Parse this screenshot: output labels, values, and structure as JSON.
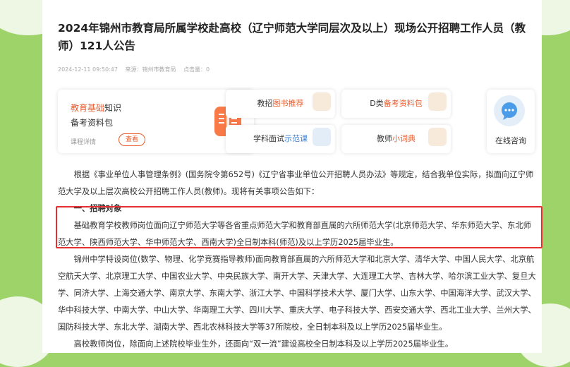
{
  "article": {
    "title": "2024年锦州市教育局所属学校赴高校（辽宁师范大学同层次及以上）现场公开招聘工作人员（教师）121人公告",
    "date": "2024-12-11 09:50:47",
    "source": "来源：锦州市教育局",
    "views": "点击量：0"
  },
  "promo": {
    "big_card": {
      "line1_highlight": "教育基础",
      "line1_rest": "知识",
      "line2": "备考资料包",
      "detail": "课程详情",
      "button": "查看",
      "icon": "book-icon"
    },
    "cards": [
      {
        "prefix": "教招",
        "highlight": "图书推荐",
        "suffix": ""
      },
      {
        "prefix": "D类",
        "highlight": "备考资料包",
        "suffix": ""
      },
      {
        "prefix": "学科面试",
        "highlight": "示范课",
        "suffix": ""
      },
      {
        "prefix": "教师",
        "highlight": "小词典",
        "suffix": ""
      }
    ],
    "right_card": {
      "label": "在线咨询",
      "icon": "chat-icon"
    }
  },
  "body": {
    "para1": "根据《事业单位人事管理条例》(国务院令第652号)《辽宁省事业单位公开招聘人员办法》等规定，结合我单位实际，拟面向辽宁师范大学及以上层次高校公开招聘工作人员(教师)。现将有关事项公告如下：",
    "section1": "一、招聘对象",
    "para2": "基础教育学校教师岗位面向辽宁师范大学等各省重点师范大学和教育部直属的六所师范大学(北京师范大学、华东师范大学、东北师范大学、陕西师范大学、华中师范大学、西南大学)全日制本科(师范)及以上学历2025届毕业生。",
    "para3": "锦州中学特设岗位(数学、物理、化学竞赛指导教师)面向教育部直属的六所师范大学和北京大学、清华大学、中国人民大学、北京航空航天大学、北京理工大学、中国农业大学、中央民族大学、南开大学、天津大学、大连理工大学、吉林大学、哈尔滨工业大学、复旦大学、同济大学、上海交通大学、南京大学、东南大学、浙江大学、中国科学技术大学、厦门大学、山东大学、中国海洋大学、武汉大学、华中科技大学、中南大学、中山大学、华南理工大学、四川大学、重庆大学、电子科技大学、西安交通大学、西北工业大学、兰州大学、国防科技大学、东北大学、湖南大学、西北农林科技大学等37所院校，全日制本科及以上学历2025届毕业生。",
    "para4": "高校教师岗位，除面向上述院校毕业生外，还面向“双一流”建设高校全日制本科及以上学历2025届毕业生。"
  },
  "colors": {
    "accent": "#e95b2c",
    "highlight_border": "#e53030",
    "background": "#9ed36a"
  }
}
